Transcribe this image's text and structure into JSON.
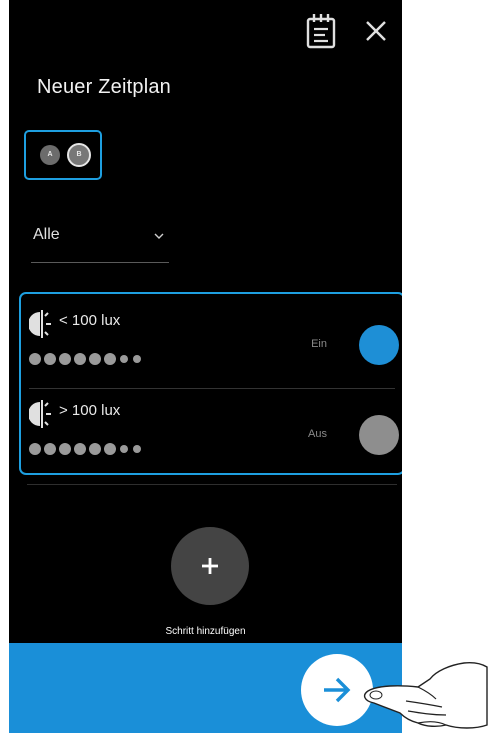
{
  "header": {
    "title": "Neuer Zeitplan",
    "calendar_icon": "calendar-list-icon",
    "close_icon": "close-icon"
  },
  "devices": [
    {
      "label": "A",
      "selected": false
    },
    {
      "label": "B",
      "selected": true
    }
  ],
  "filter": {
    "value": "Alle",
    "arrow_icon": "chevron-down-icon"
  },
  "steps": [
    {
      "condition": "< 100 lux",
      "state_label": "Ein",
      "toggle_on": true,
      "icon": "light-sensor-icon"
    },
    {
      "condition": "> 100 lux",
      "state_label": "Aus",
      "toggle_on": false,
      "icon": "light-sensor-icon"
    }
  ],
  "add_step": {
    "label": "Schritt hinzufügen",
    "icon": "plus-icon"
  },
  "next": {
    "icon": "arrow-right-icon"
  },
  "colors": {
    "background": "#000000",
    "accent": "#1a8fd8",
    "highlight_border": "#1e9fe0",
    "toggle_on": "#1e8fd6",
    "toggle_off": "#8e8e8e"
  }
}
